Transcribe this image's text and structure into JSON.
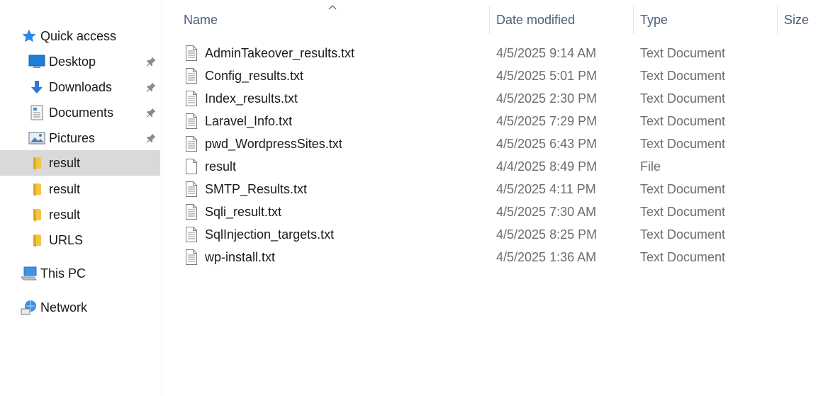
{
  "nav": {
    "quick_access": "Quick access",
    "items": [
      {
        "label": "Desktop",
        "icon": "desktop-icon",
        "pinned": true
      },
      {
        "label": "Downloads",
        "icon": "downloads-icon",
        "pinned": true
      },
      {
        "label": "Documents",
        "icon": "documents-icon",
        "pinned": true
      },
      {
        "label": "Pictures",
        "icon": "pictures-icon",
        "pinned": true
      },
      {
        "label": "result",
        "icon": "folder-icon",
        "pinned": false,
        "selected": true
      },
      {
        "label": "result",
        "icon": "folder-icon",
        "pinned": false
      },
      {
        "label": "result",
        "icon": "folder-icon",
        "pinned": false
      },
      {
        "label": "URLS",
        "icon": "folder-icon",
        "pinned": false
      }
    ],
    "this_pc": "This PC",
    "network": "Network"
  },
  "columns": {
    "name": "Name",
    "date": "Date modified",
    "type": "Type",
    "size": "Size"
  },
  "files": [
    {
      "name": "AdminTakeover_results.txt",
      "date": "4/5/2025 9:14 AM",
      "type": "Text Document",
      "icon": "text-file-icon"
    },
    {
      "name": "Config_results.txt",
      "date": "4/5/2025 5:01 PM",
      "type": "Text Document",
      "icon": "text-file-icon"
    },
    {
      "name": "Index_results.txt",
      "date": "4/5/2025 2:30 PM",
      "type": "Text Document",
      "icon": "text-file-icon"
    },
    {
      "name": "Laravel_Info.txt",
      "date": "4/5/2025 7:29 PM",
      "type": "Text Document",
      "icon": "text-file-icon"
    },
    {
      "name": "pwd_WordpressSites.txt",
      "date": "4/5/2025 6:43 PM",
      "type": "Text Document",
      "icon": "text-file-icon"
    },
    {
      "name": "result",
      "date": "4/4/2025 8:49 PM",
      "type": "File",
      "icon": "blank-file-icon"
    },
    {
      "name": "SMTP_Results.txt",
      "date": "4/5/2025 4:11 PM",
      "type": "Text Document",
      "icon": "text-file-icon"
    },
    {
      "name": "Sqli_result.txt",
      "date": "4/5/2025 7:30 AM",
      "type": "Text Document",
      "icon": "text-file-icon"
    },
    {
      "name": "SqlInjection_targets.txt",
      "date": "4/5/2025 8:25 PM",
      "type": "Text Document",
      "icon": "text-file-icon"
    },
    {
      "name": "wp-install.txt",
      "date": "4/5/2025 1:36 AM",
      "type": "Text Document",
      "icon": "text-file-icon"
    }
  ],
  "colors": {
    "selected_bg": "#d9d9d9",
    "header_text": "#4c607a",
    "secondary_text": "#6d6d6d",
    "folder": "#f4c542",
    "accent_blue": "#1e7fd8"
  }
}
